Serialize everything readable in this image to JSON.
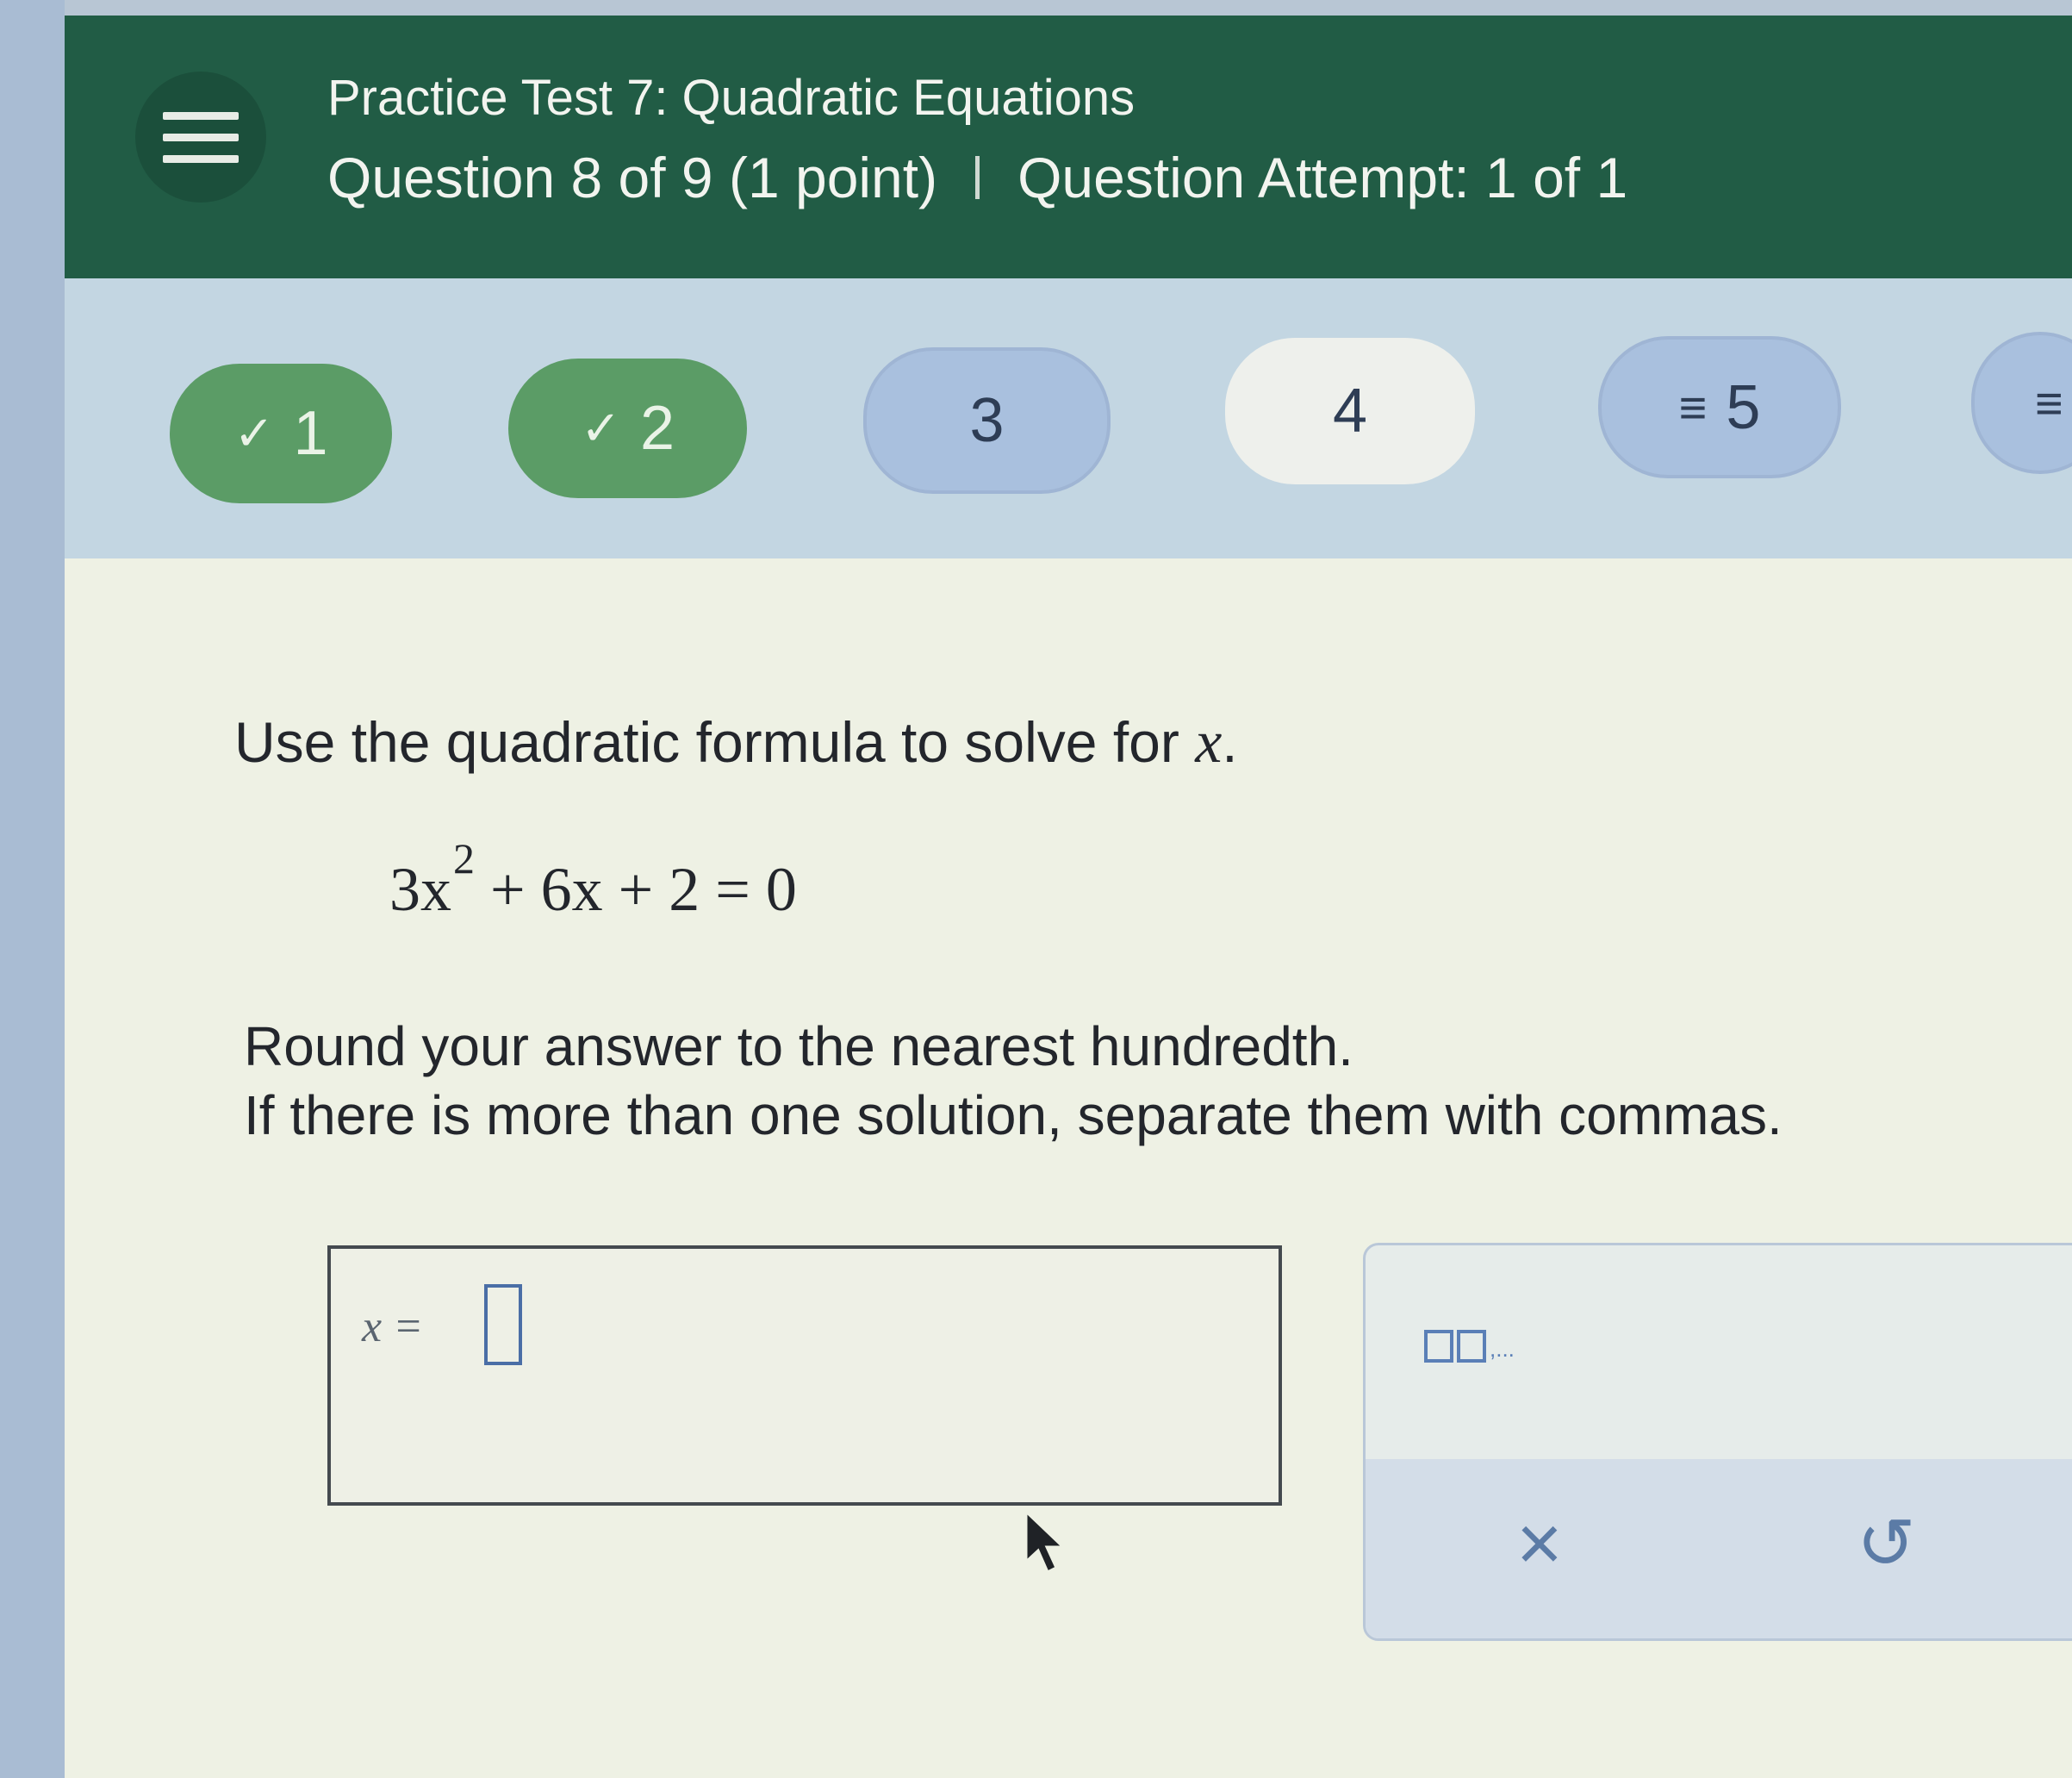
{
  "header": {
    "title": "Practice Test 7: Quadratic Equations",
    "question_info": "Question 8 of 9 (1 point)",
    "attempt_info": "Question Attempt: 1 of 1"
  },
  "nav": {
    "q1": {
      "label": "1",
      "status": "answered"
    },
    "q2": {
      "label": "2",
      "status": "answered"
    },
    "q3": {
      "label": "3",
      "status": "unanswered"
    },
    "q4": {
      "label": "4",
      "status": "unanswered"
    },
    "q5": {
      "label": "5",
      "status": "flagged"
    },
    "q6": {
      "label": "",
      "status": "flagged"
    }
  },
  "question": {
    "instruction": "Use the quadratic formula to solve for ",
    "variable": "x",
    "instruction_end": ".",
    "equation_lhs": "3x",
    "equation_exp": "2",
    "equation_rest": " + 6x + 2 = 0",
    "round_note": "Round your answer to the nearest hundredth.",
    "multi_note": "If there is more than one solution, separate them with commas."
  },
  "answer": {
    "label": "x =",
    "value": ""
  },
  "tools": {
    "list_suffix": ",...",
    "clear_symbol": "×",
    "undo_symbol": "↺"
  },
  "colors": {
    "header_bg": "#215c45",
    "answered_green": "#5b9c66",
    "pill_blue": "#a9c0de",
    "accent_blue": "#4a6ea6"
  }
}
